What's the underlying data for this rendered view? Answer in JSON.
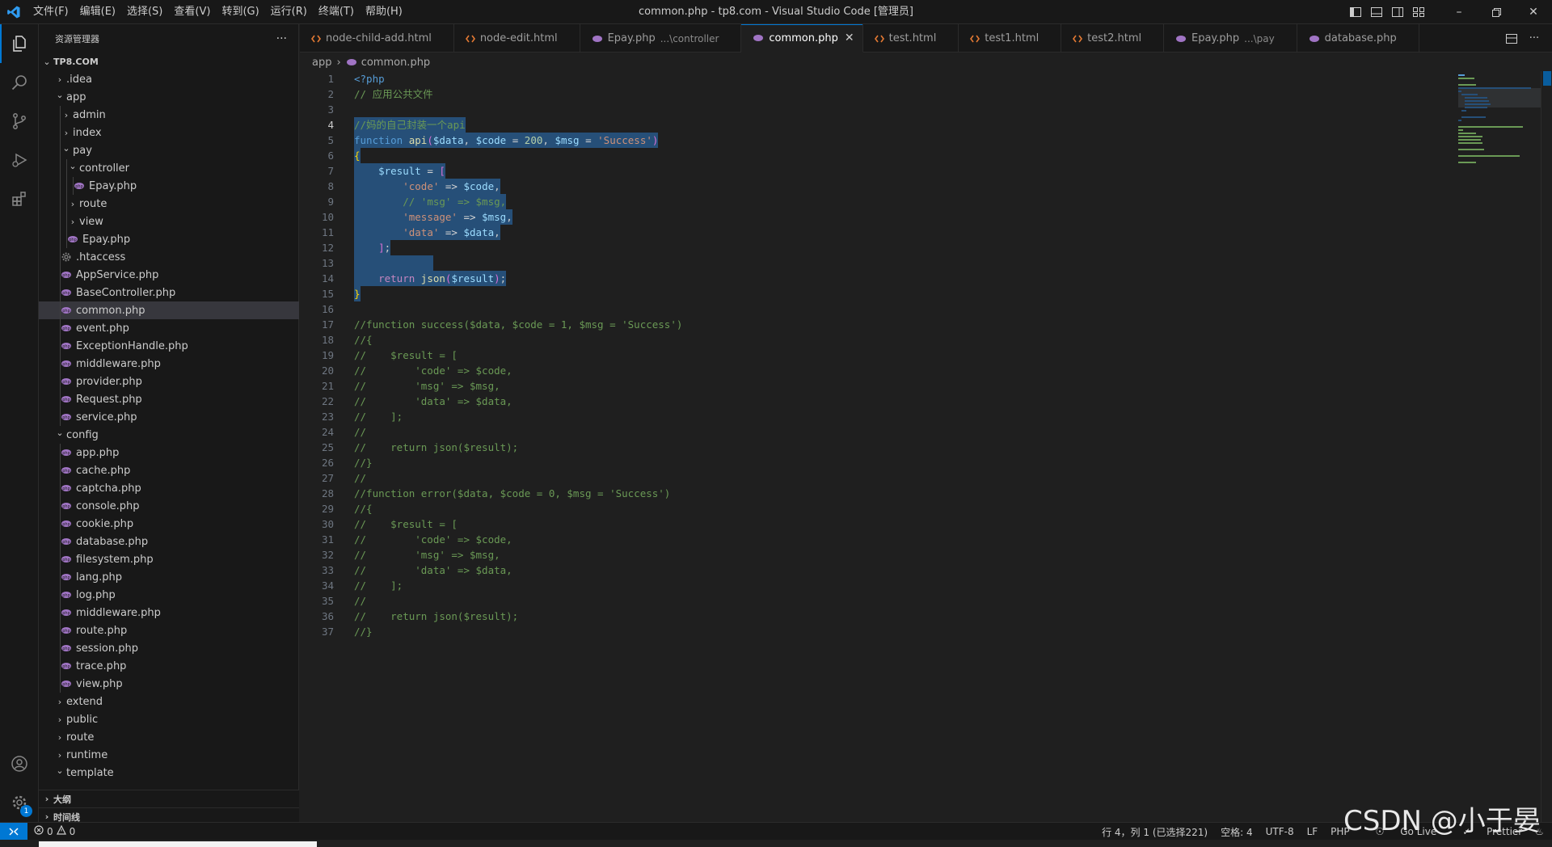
{
  "window": {
    "title": "common.php - tp8.com - Visual Studio Code [管理员]",
    "menu": [
      "文件(F)",
      "编辑(E)",
      "选择(S)",
      "查看(V)",
      "转到(G)",
      "运行(R)",
      "终端(T)",
      "帮助(H)"
    ]
  },
  "explorer": {
    "header": "资源管理器",
    "more": "···",
    "root": "TP8.COM",
    "items": [
      {
        "label": ".idea",
        "depth": 1,
        "kind": "folder",
        "open": false
      },
      {
        "label": "app",
        "depth": 1,
        "kind": "folder",
        "open": true
      },
      {
        "label": "admin",
        "depth": 2,
        "kind": "folder",
        "open": false
      },
      {
        "label": "index",
        "depth": 2,
        "kind": "folder",
        "open": false
      },
      {
        "label": "pay",
        "depth": 2,
        "kind": "folder",
        "open": true
      },
      {
        "label": "controller",
        "depth": 3,
        "kind": "folder",
        "open": true
      },
      {
        "label": "Epay.php",
        "depth": 4,
        "kind": "php"
      },
      {
        "label": "route",
        "depth": 3,
        "kind": "folder",
        "open": false
      },
      {
        "label": "view",
        "depth": 3,
        "kind": "folder",
        "open": false
      },
      {
        "label": "Epay.php",
        "depth": 3,
        "kind": "php"
      },
      {
        "label": ".htaccess",
        "depth": 2,
        "kind": "gear"
      },
      {
        "label": "AppService.php",
        "depth": 2,
        "kind": "php"
      },
      {
        "label": "BaseController.php",
        "depth": 2,
        "kind": "php"
      },
      {
        "label": "common.php",
        "depth": 2,
        "kind": "php",
        "selected": true
      },
      {
        "label": "event.php",
        "depth": 2,
        "kind": "php"
      },
      {
        "label": "ExceptionHandle.php",
        "depth": 2,
        "kind": "php"
      },
      {
        "label": "middleware.php",
        "depth": 2,
        "kind": "php"
      },
      {
        "label": "provider.php",
        "depth": 2,
        "kind": "php"
      },
      {
        "label": "Request.php",
        "depth": 2,
        "kind": "php"
      },
      {
        "label": "service.php",
        "depth": 2,
        "kind": "php"
      },
      {
        "label": "config",
        "depth": 1,
        "kind": "folder",
        "open": true
      },
      {
        "label": "app.php",
        "depth": 2,
        "kind": "php"
      },
      {
        "label": "cache.php",
        "depth": 2,
        "kind": "php"
      },
      {
        "label": "captcha.php",
        "depth": 2,
        "kind": "php"
      },
      {
        "label": "console.php",
        "depth": 2,
        "kind": "php"
      },
      {
        "label": "cookie.php",
        "depth": 2,
        "kind": "php"
      },
      {
        "label": "database.php",
        "depth": 2,
        "kind": "php"
      },
      {
        "label": "filesystem.php",
        "depth": 2,
        "kind": "php"
      },
      {
        "label": "lang.php",
        "depth": 2,
        "kind": "php"
      },
      {
        "label": "log.php",
        "depth": 2,
        "kind": "php"
      },
      {
        "label": "middleware.php",
        "depth": 2,
        "kind": "php"
      },
      {
        "label": "route.php",
        "depth": 2,
        "kind": "php"
      },
      {
        "label": "session.php",
        "depth": 2,
        "kind": "php"
      },
      {
        "label": "trace.php",
        "depth": 2,
        "kind": "php"
      },
      {
        "label": "view.php",
        "depth": 2,
        "kind": "php"
      },
      {
        "label": "extend",
        "depth": 1,
        "kind": "folder",
        "open": false
      },
      {
        "label": "public",
        "depth": 1,
        "kind": "folder",
        "open": false
      },
      {
        "label": "route",
        "depth": 1,
        "kind": "folder",
        "open": false
      },
      {
        "label": "runtime",
        "depth": 1,
        "kind": "folder",
        "open": false
      },
      {
        "label": "template",
        "depth": 1,
        "kind": "folder",
        "open": true
      }
    ],
    "outline": "大纲",
    "timeline": "时间线"
  },
  "tabs": [
    {
      "label": "node-child-add.html",
      "desc": "",
      "kind": "html"
    },
    {
      "label": "node-edit.html",
      "desc": "",
      "kind": "html"
    },
    {
      "label": "Epay.php",
      "desc": "...\\controller",
      "kind": "php"
    },
    {
      "label": "common.php",
      "desc": "",
      "kind": "php",
      "active": true
    },
    {
      "label": "test.html",
      "desc": "",
      "kind": "html"
    },
    {
      "label": "test1.html",
      "desc": "",
      "kind": "html"
    },
    {
      "label": "test2.html",
      "desc": "",
      "kind": "html"
    },
    {
      "label": "Epay.php",
      "desc": "...\\pay",
      "kind": "php"
    },
    {
      "label": "database.php",
      "desc": "",
      "kind": "php"
    }
  ],
  "breadcrumb": {
    "folder": "app",
    "file": "common.php"
  },
  "code": {
    "current_line": 4,
    "selection_lines": [
      4,
      15
    ],
    "lines": [
      "<?php",
      "// 应用公共文件",
      "",
      "//妈的自己封装一个api",
      "function api($data, $code = 200, $msg = 'Success')",
      "{",
      "    $result = [",
      "        'code' => $code,",
      "        // 'msg' => $msg,",
      "        'message' => $msg,",
      "        'data' => $data,",
      "    ];",
      "",
      "    return json($result);",
      "}",
      "",
      "//function success($data, $code = 1, $msg = 'Success')",
      "//{",
      "//    $result = [",
      "//        'code' => $code,",
      "//        'msg' => $msg,",
      "//        'data' => $data,",
      "//    ];",
      "//",
      "//    return json($result);",
      "//}",
      "//",
      "//function error($data, $code = 0, $msg = 'Success')",
      "//{",
      "//    $result = [",
      "//        'code' => $code,",
      "//        'msg' => $msg,",
      "//        'data' => $data,",
      "//    ];",
      "//",
      "//    return json($result);",
      "//}"
    ]
  },
  "status": {
    "problems_errors": "0",
    "problems_warnings": "0",
    "cursor": "行 4，列 1 (已选择221)",
    "spaces": "空格: 4",
    "encoding": "UTF-8",
    "eol": "LF",
    "language": "PHP",
    "golive": "Go Live",
    "prettier": "Prettier"
  },
  "watermark": "CSDN @小于晏",
  "accounts_badge": "1",
  "colors": {
    "accent": "#0078d4",
    "selection": "#264f78",
    "comment": "#6a9955",
    "php_icon": "#a074c4",
    "html_icon": "#e37933"
  }
}
